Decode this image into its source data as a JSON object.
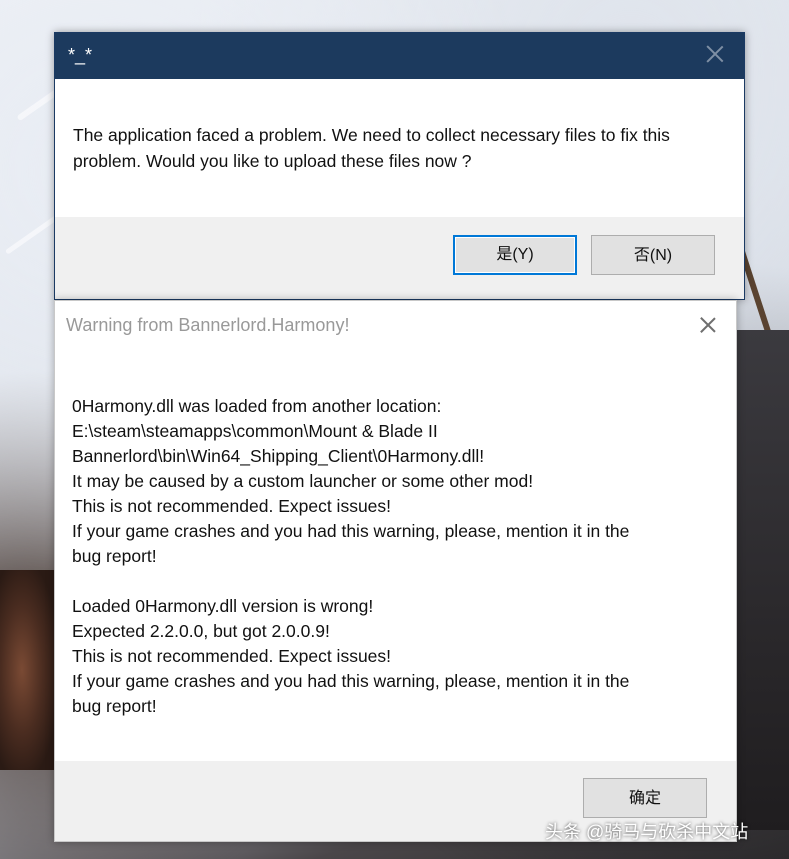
{
  "dialog1": {
    "title": "*_*",
    "message": "The application faced a problem. We need to collect necessary files to fix this problem. Would you like to upload these files now ?",
    "yes_label": "是(Y)",
    "no_label": "否(N)"
  },
  "dialog2": {
    "title": "Warning from Bannerlord.Harmony!",
    "lines": [
      "0Harmony.dll was loaded from another location:",
      "E:\\steam\\steamapps\\common\\Mount & Blade II",
      "Bannerlord\\bin\\Win64_Shipping_Client\\0Harmony.dll!",
      "It may be caused by a custom launcher or some other mod!",
      "This is not recommended. Expect issues!",
      "If your game crashes and you had this warning, please, mention it in the",
      "bug report!",
      "",
      "Loaded 0Harmony.dll version is wrong!",
      "Expected 2.2.0.0, but got 2.0.0.9!",
      "This is not recommended. Expect issues!",
      "If your game crashes and you had this warning, please, mention it in the",
      "bug report!"
    ],
    "ok_label": "确定"
  },
  "watermark": "头条 @骑马与砍杀中文站",
  "colors": {
    "titlebar": "#1c3a5e",
    "focus_border": "#0078d7",
    "footer_bg": "#f0f0f0"
  },
  "icons": {
    "dialog1_close": "close-icon",
    "dialog2_close": "close-icon"
  }
}
